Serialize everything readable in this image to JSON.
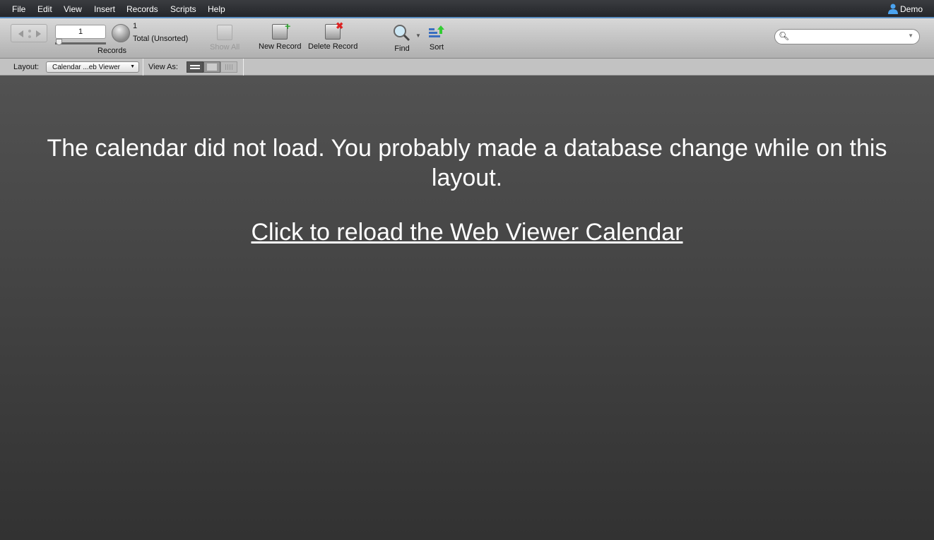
{
  "menu": {
    "items": [
      "File",
      "Edit",
      "View",
      "Insert",
      "Records",
      "Scripts",
      "Help"
    ],
    "user": "Demo"
  },
  "toolbar": {
    "record_number": "1",
    "found_count": "1",
    "total_label": "Total (Unsorted)",
    "records_label": "Records",
    "show_all": "Show All",
    "new_record": "New Record",
    "delete_record": "Delete Record",
    "find": "Find",
    "sort": "Sort",
    "search_value": ""
  },
  "layoutbar": {
    "layout_label": "Layout:",
    "layout_value": "Calendar ...eb Viewer",
    "view_as_label": "View As:"
  },
  "content": {
    "message": "The calendar did not load. You probably made a database change while on this layout.",
    "reload_link": "Click to reload the Web Viewer Calendar"
  }
}
